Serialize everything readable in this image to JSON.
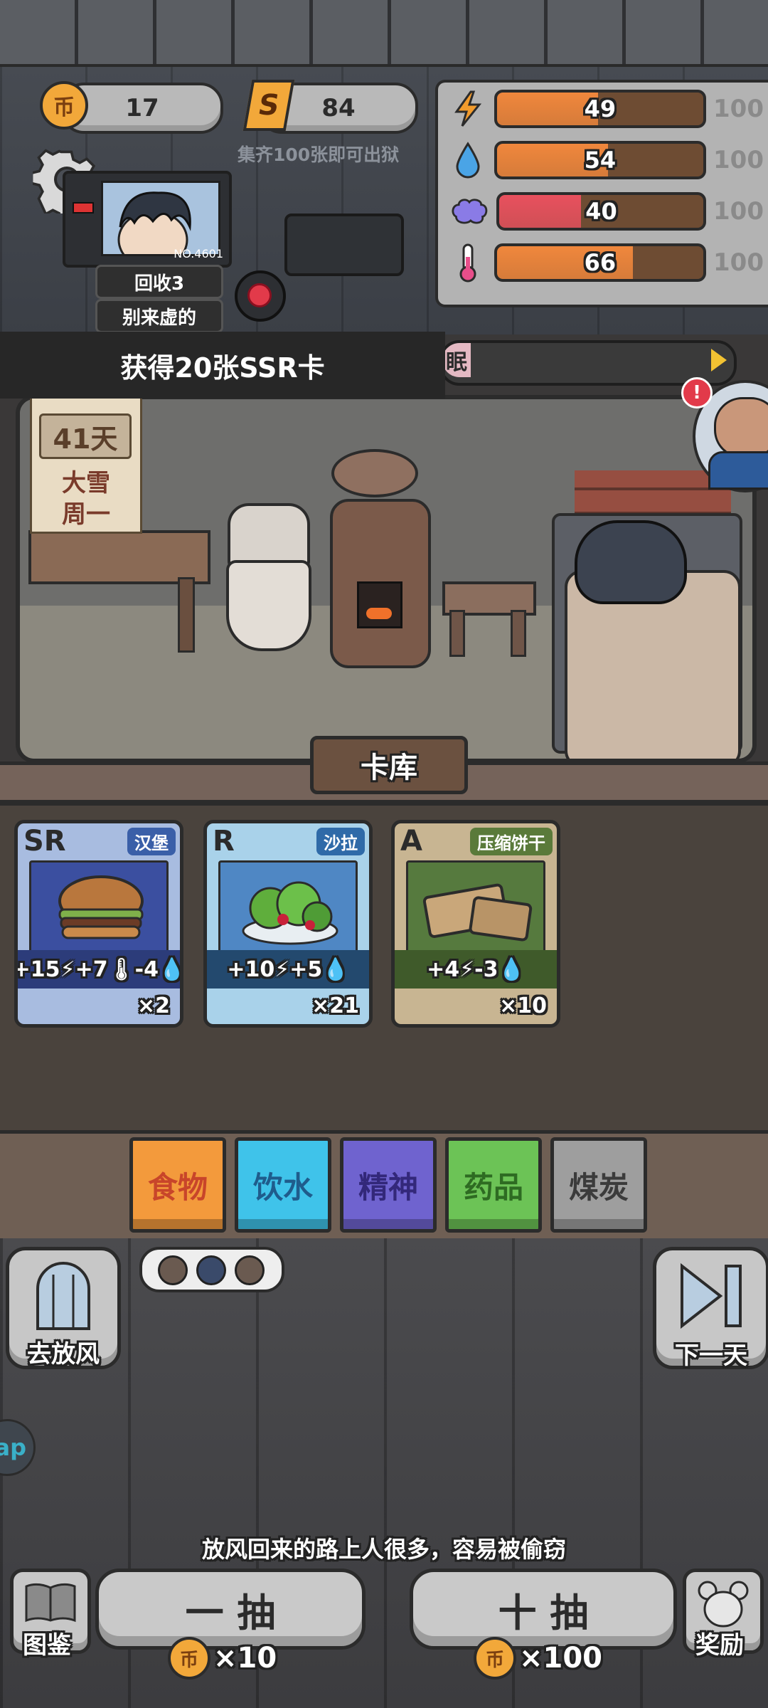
{
  "currency": {
    "coin_icon": "币",
    "coins": "17",
    "shard_icon": "S",
    "shards": "84",
    "collect_hint": "集齐100张即可出狱"
  },
  "player": {
    "prisoner_no": "NO.4601",
    "recycle_tag": "回收3",
    "motto_tag": "别来虚的"
  },
  "stats": [
    {
      "name": "energy",
      "icon": "lightning-icon",
      "value": 49,
      "max": "100",
      "color": "#f0873c"
    },
    {
      "name": "water",
      "icon": "water-drop-icon",
      "value": 54,
      "max": "100",
      "color": "#f0873c"
    },
    {
      "name": "mind",
      "icon": "brain-icon",
      "value": 40,
      "max": "100",
      "color": "#e8505e"
    },
    {
      "name": "temperature",
      "icon": "thermometer-icon",
      "value": 66,
      "max": "100",
      "color": "#f0873c"
    }
  ],
  "stat_values": {
    "energy": "49",
    "water": "54",
    "mind": "40",
    "temperature": "66"
  },
  "stat_max": {
    "energy": "100",
    "water": "100",
    "mind": "100",
    "temperature": "100"
  },
  "notification": "获得20张SSR卡",
  "event_bar_text": "眠",
  "calendar": {
    "day": "41天",
    "weather": "大雪",
    "weekday": "周一"
  },
  "card_library_label": "卡库",
  "cards": [
    {
      "rarity": "SR",
      "name": "汉堡",
      "effects": "+15⚡+7🌡-4💧",
      "count": "×2"
    },
    {
      "rarity": "R",
      "name": "沙拉",
      "effects": "+10⚡+5💧",
      "count": "×21"
    },
    {
      "rarity": "A",
      "name": "压缩饼干",
      "effects": "+4⚡-3💧",
      "count": "×10"
    }
  ],
  "categories": [
    {
      "label": "食物",
      "color": "#f39a3c",
      "selected": true
    },
    {
      "label": "饮水",
      "color": "#3fc3ea",
      "selected": false
    },
    {
      "label": "精神",
      "color": "#6f63cf",
      "selected": false
    },
    {
      "label": "药品",
      "color": "#6cc356",
      "selected": false
    },
    {
      "label": "煤炭",
      "color": "#9e9e9e",
      "selected": false
    }
  ],
  "actions": {
    "go_out_label": "去放风",
    "next_day_label": "下一天",
    "hint": "放风回来的路上人很多，容易被偷窃",
    "handbook_label": "图鉴",
    "reward_label": "奖励",
    "side_tab_label": "ap",
    "draw_one_label": "一 抽",
    "draw_one_price": "×10",
    "draw_ten_label": "十 抽",
    "draw_ten_price": "×100"
  }
}
